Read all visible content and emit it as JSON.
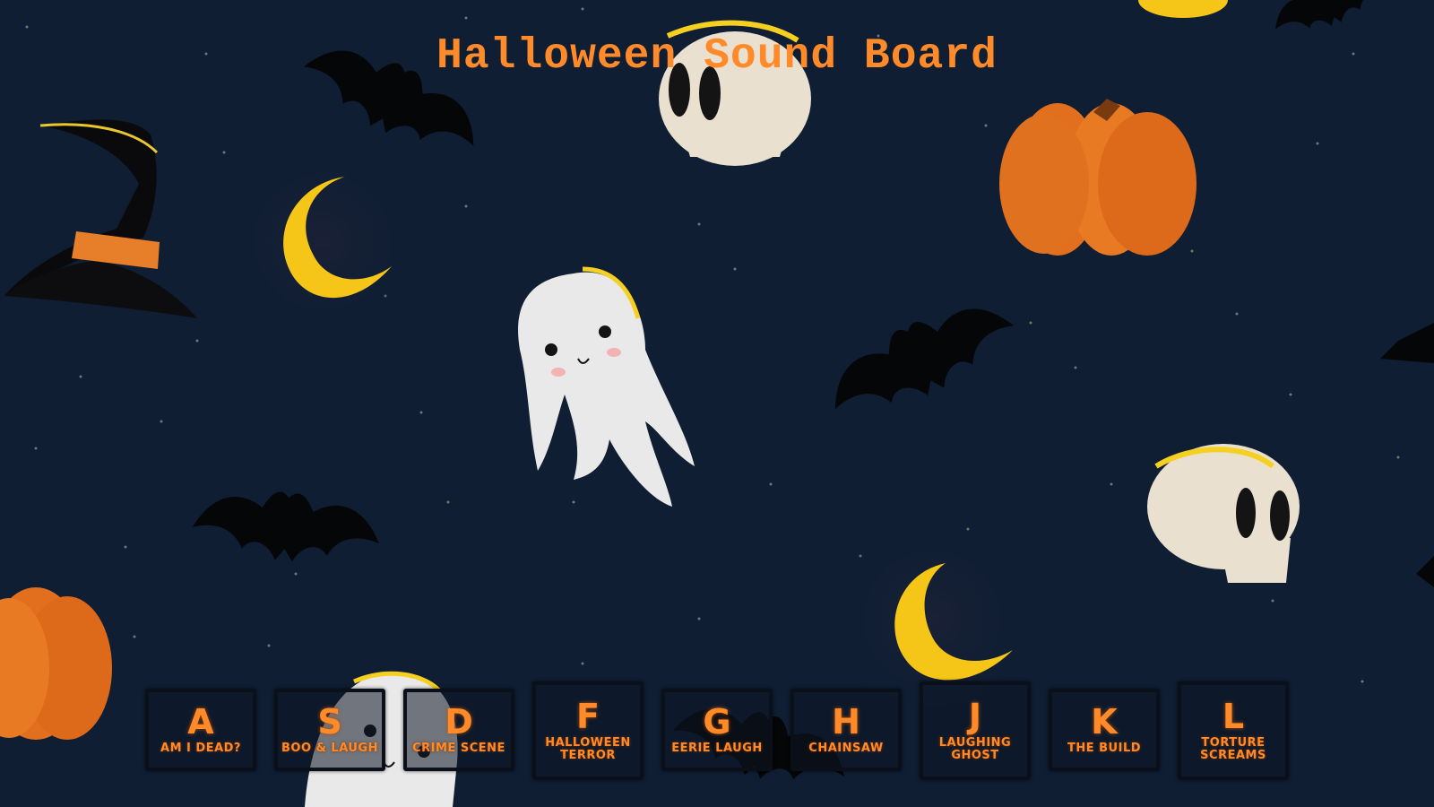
{
  "page": {
    "title": "Halloween Sound Board"
  },
  "colors": {
    "background": "#0f1e33",
    "accent": "#ff8a2a",
    "key_border": "#0a0f1a"
  },
  "decorations": [
    "witch-hat-icon",
    "bat-icon",
    "skull-icon",
    "moon-icon",
    "pumpkin-icon",
    "ghost-icon"
  ],
  "keys": [
    {
      "letter": "A",
      "label": "AM I DEAD?"
    },
    {
      "letter": "S",
      "label": "BOO & LAUGH"
    },
    {
      "letter": "D",
      "label": "CRIME SCENE"
    },
    {
      "letter": "F",
      "label": "HALLOWEEN TERROR"
    },
    {
      "letter": "G",
      "label": "EERIE LAUGH"
    },
    {
      "letter": "H",
      "label": "CHAINSAW"
    },
    {
      "letter": "J",
      "label": "LAUGHING GHOST"
    },
    {
      "letter": "K",
      "label": "THE BUILD"
    },
    {
      "letter": "L",
      "label": "TORTURE SCREAMS"
    }
  ]
}
